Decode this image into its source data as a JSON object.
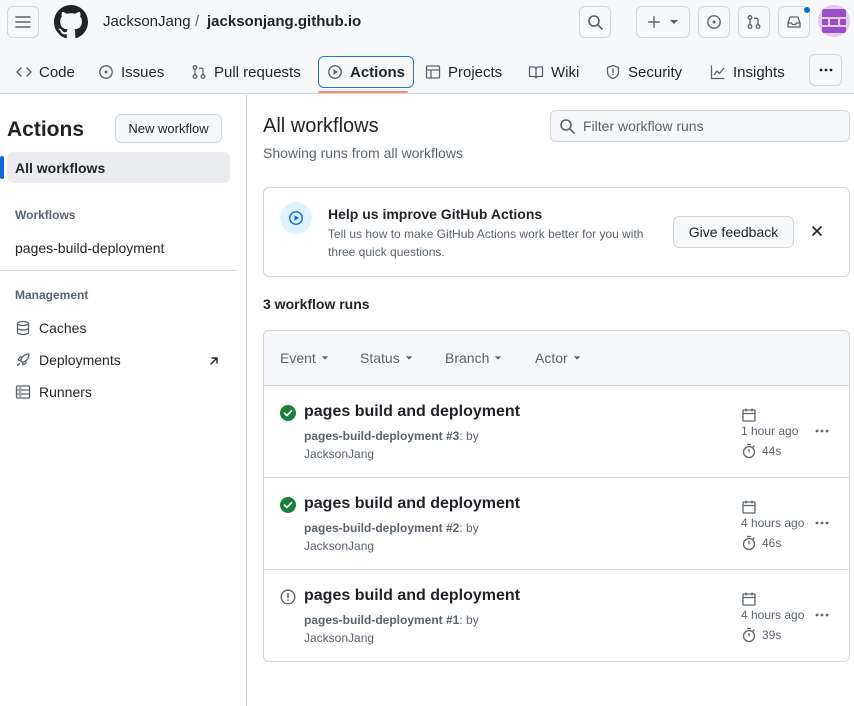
{
  "header": {
    "owner": "JacksonJang",
    "separator": "/",
    "repo": "jacksonjang.github.io"
  },
  "tabs": [
    {
      "label": "Code",
      "icon": "code-icon"
    },
    {
      "label": "Issues",
      "icon": "issue-icon"
    },
    {
      "label": "Pull requests",
      "icon": "pull-request-icon"
    },
    {
      "label": "Actions",
      "icon": "play-icon",
      "active": true
    },
    {
      "label": "Projects",
      "icon": "table-icon"
    },
    {
      "label": "Wiki",
      "icon": "book-icon"
    },
    {
      "label": "Security",
      "icon": "shield-icon"
    },
    {
      "label": "Insights",
      "icon": "graph-icon"
    }
  ],
  "sidebar": {
    "title": "Actions",
    "new_workflow": "New workflow",
    "all_workflows": "All workflows",
    "workflows_heading": "Workflows",
    "workflow_items": [
      "pages-build-deployment"
    ],
    "management_heading": "Management",
    "management_items": [
      "Caches",
      "Deployments",
      "Runners"
    ]
  },
  "main": {
    "title": "All workflows",
    "subtitle": "Showing runs from all workflows",
    "filter_placeholder": "Filter workflow runs"
  },
  "banner": {
    "title": "Help us improve GitHub Actions",
    "text": "Tell us how to make GitHub Actions work better for you with three quick questions.",
    "button": "Give feedback"
  },
  "runs": {
    "count_label": "3 workflow runs",
    "filters": [
      "Event",
      "Status",
      "Branch",
      "Actor"
    ],
    "items": [
      {
        "title": "pages build and deployment",
        "workflow": "pages-build-deployment #3",
        "by": ": by",
        "actor": "JacksonJang",
        "time": "1 hour ago",
        "duration": "44s",
        "status": "success"
      },
      {
        "title": "pages build and deployment",
        "workflow": "pages-build-deployment #2",
        "by": ": by",
        "actor": "JacksonJang",
        "time": "4 hours ago",
        "duration": "46s",
        "status": "success"
      },
      {
        "title": "pages build and deployment",
        "workflow": "pages-build-deployment #1",
        "by": ": by",
        "actor": "JacksonJang",
        "time": "4 hours ago",
        "duration": "39s",
        "status": "neutral"
      }
    ]
  },
  "colors": {
    "accent": "#0969da",
    "success": "#1a7f37",
    "tab_underline": "#fd8c73"
  }
}
